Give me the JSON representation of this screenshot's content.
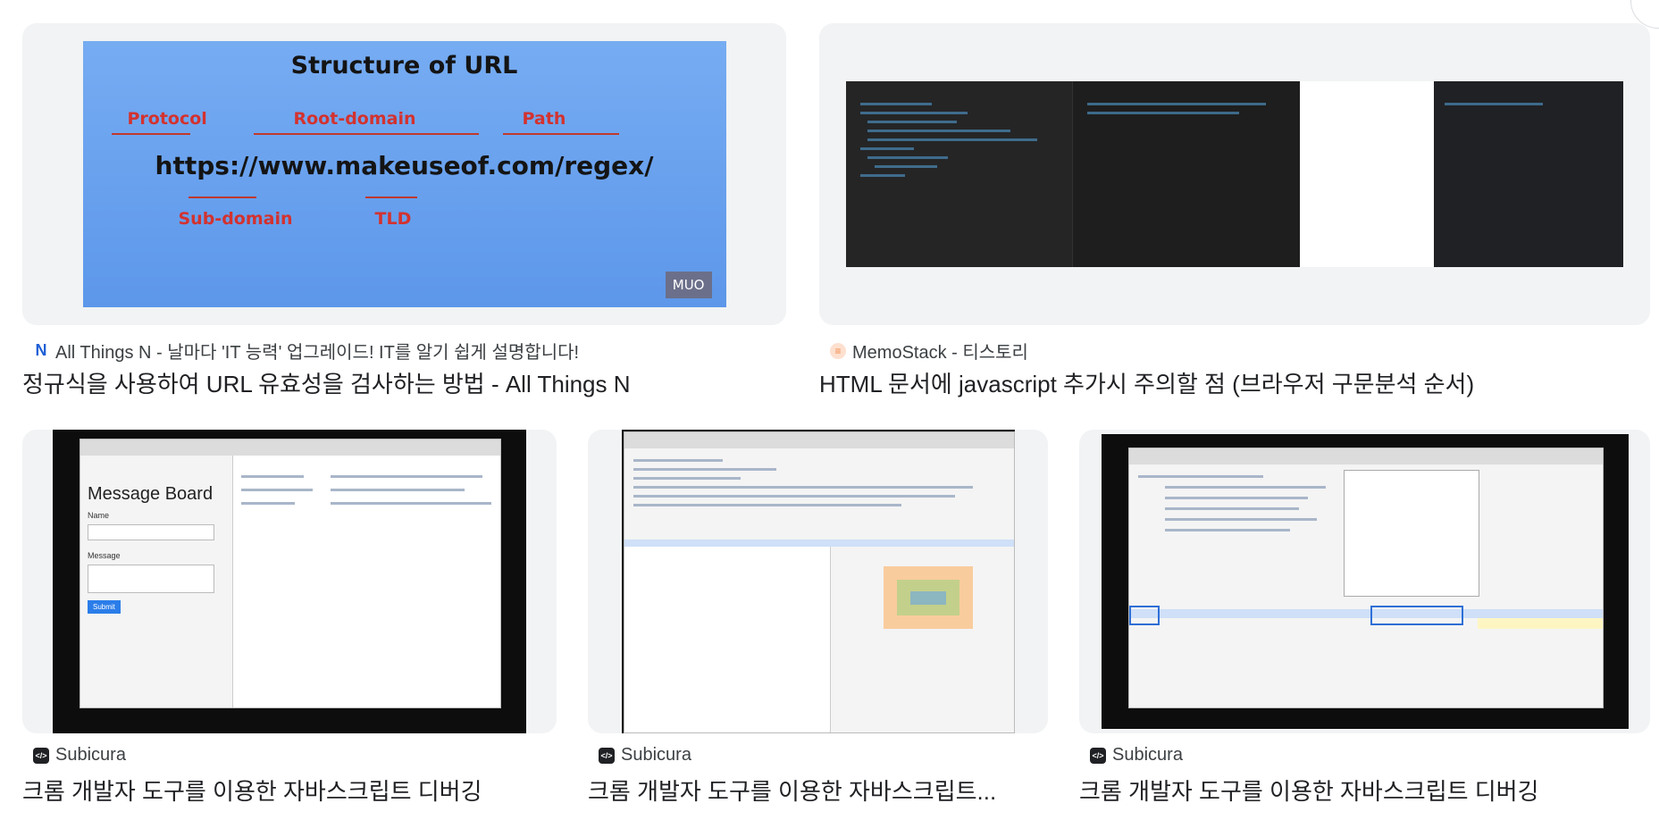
{
  "results": [
    {
      "source": "All Things N - 날마다 'IT 능력' 업그레이드! IT를 알기 쉽게 설명합니다!",
      "source_icon": "N",
      "source_icon_color": "#1f5fd6",
      "title": "정규식을 사용하여 URL 유효성을 검사하는 방법 - All Things N",
      "image": {
        "heading": "Structure of URL",
        "labels": [
          "Protocol",
          "Root-domain",
          "Path",
          "Sub-domain",
          "TLD"
        ],
        "url": "https://www.makeuseof.com/regex/",
        "mark": "MUO"
      }
    },
    {
      "source": "MemoStack - 티스토리",
      "source_icon": "≡",
      "source_icon_color": "#f28b4b",
      "title": "HTML 문서에 javascript 추가시 주의할 점 (브라우저 구문분석 순서)"
    },
    {
      "source": "Subicura",
      "source_icon": "</>",
      "source_icon_color": "#202124",
      "title": "크롬 개발자 도구를 이용한 자바스크립트 디버깅",
      "image": {
        "heading": "Message Board",
        "labels": [
          "Name",
          "Message"
        ],
        "button": "Submit"
      }
    },
    {
      "source": "Subicura",
      "source_icon": "</>",
      "source_icon_color": "#202124",
      "title": "크롬 개발자 도구를 이용한 자바스크립트..."
    },
    {
      "source": "Subicura",
      "source_icon": "</>",
      "source_icon_color": "#202124",
      "title": "크롬 개발자 도구를 이용한 자바스크립트 디버깅"
    }
  ]
}
